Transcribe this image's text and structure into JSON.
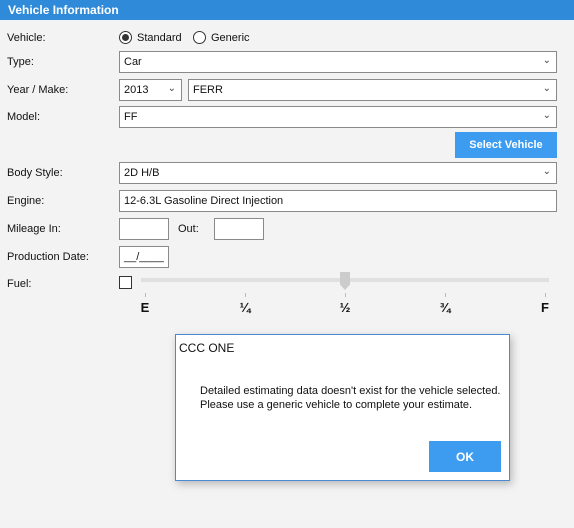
{
  "header": {
    "title": "Vehicle Information"
  },
  "vehicle": {
    "label": "Vehicle:",
    "options": [
      "Standard",
      "Generic"
    ],
    "selected": "Standard"
  },
  "type": {
    "label": "Type:",
    "value": "Car"
  },
  "year_make": {
    "label": "Year / Make:",
    "year": "2013",
    "make": "FERR"
  },
  "model": {
    "label": "Model:",
    "value": "FF"
  },
  "select_vehicle": "Select Vehicle",
  "body_style": {
    "label": "Body Style:",
    "value": "2D H/B"
  },
  "engine": {
    "label": "Engine:",
    "value": "12-6.3L Gasoline Direct Injection"
  },
  "mileage": {
    "label": "Mileage In:",
    "out_label": "Out:",
    "in": "",
    "out": ""
  },
  "production_date": {
    "label": "Production Date:",
    "value": "__/____"
  },
  "fuel": {
    "label": "Fuel:",
    "checked": false,
    "level": 0.5,
    "marks": [
      "E",
      "¼",
      "½",
      "¾",
      "F"
    ]
  },
  "dialog": {
    "title": "CCC ONE",
    "line1": "Detailed estimating data doesn't exist for the vehicle selected.",
    "line2": "Please use a generic vehicle to complete your estimate.",
    "ok": "OK"
  },
  "colors": {
    "header": "#2f8ad9",
    "button": "#3d9bf0"
  }
}
